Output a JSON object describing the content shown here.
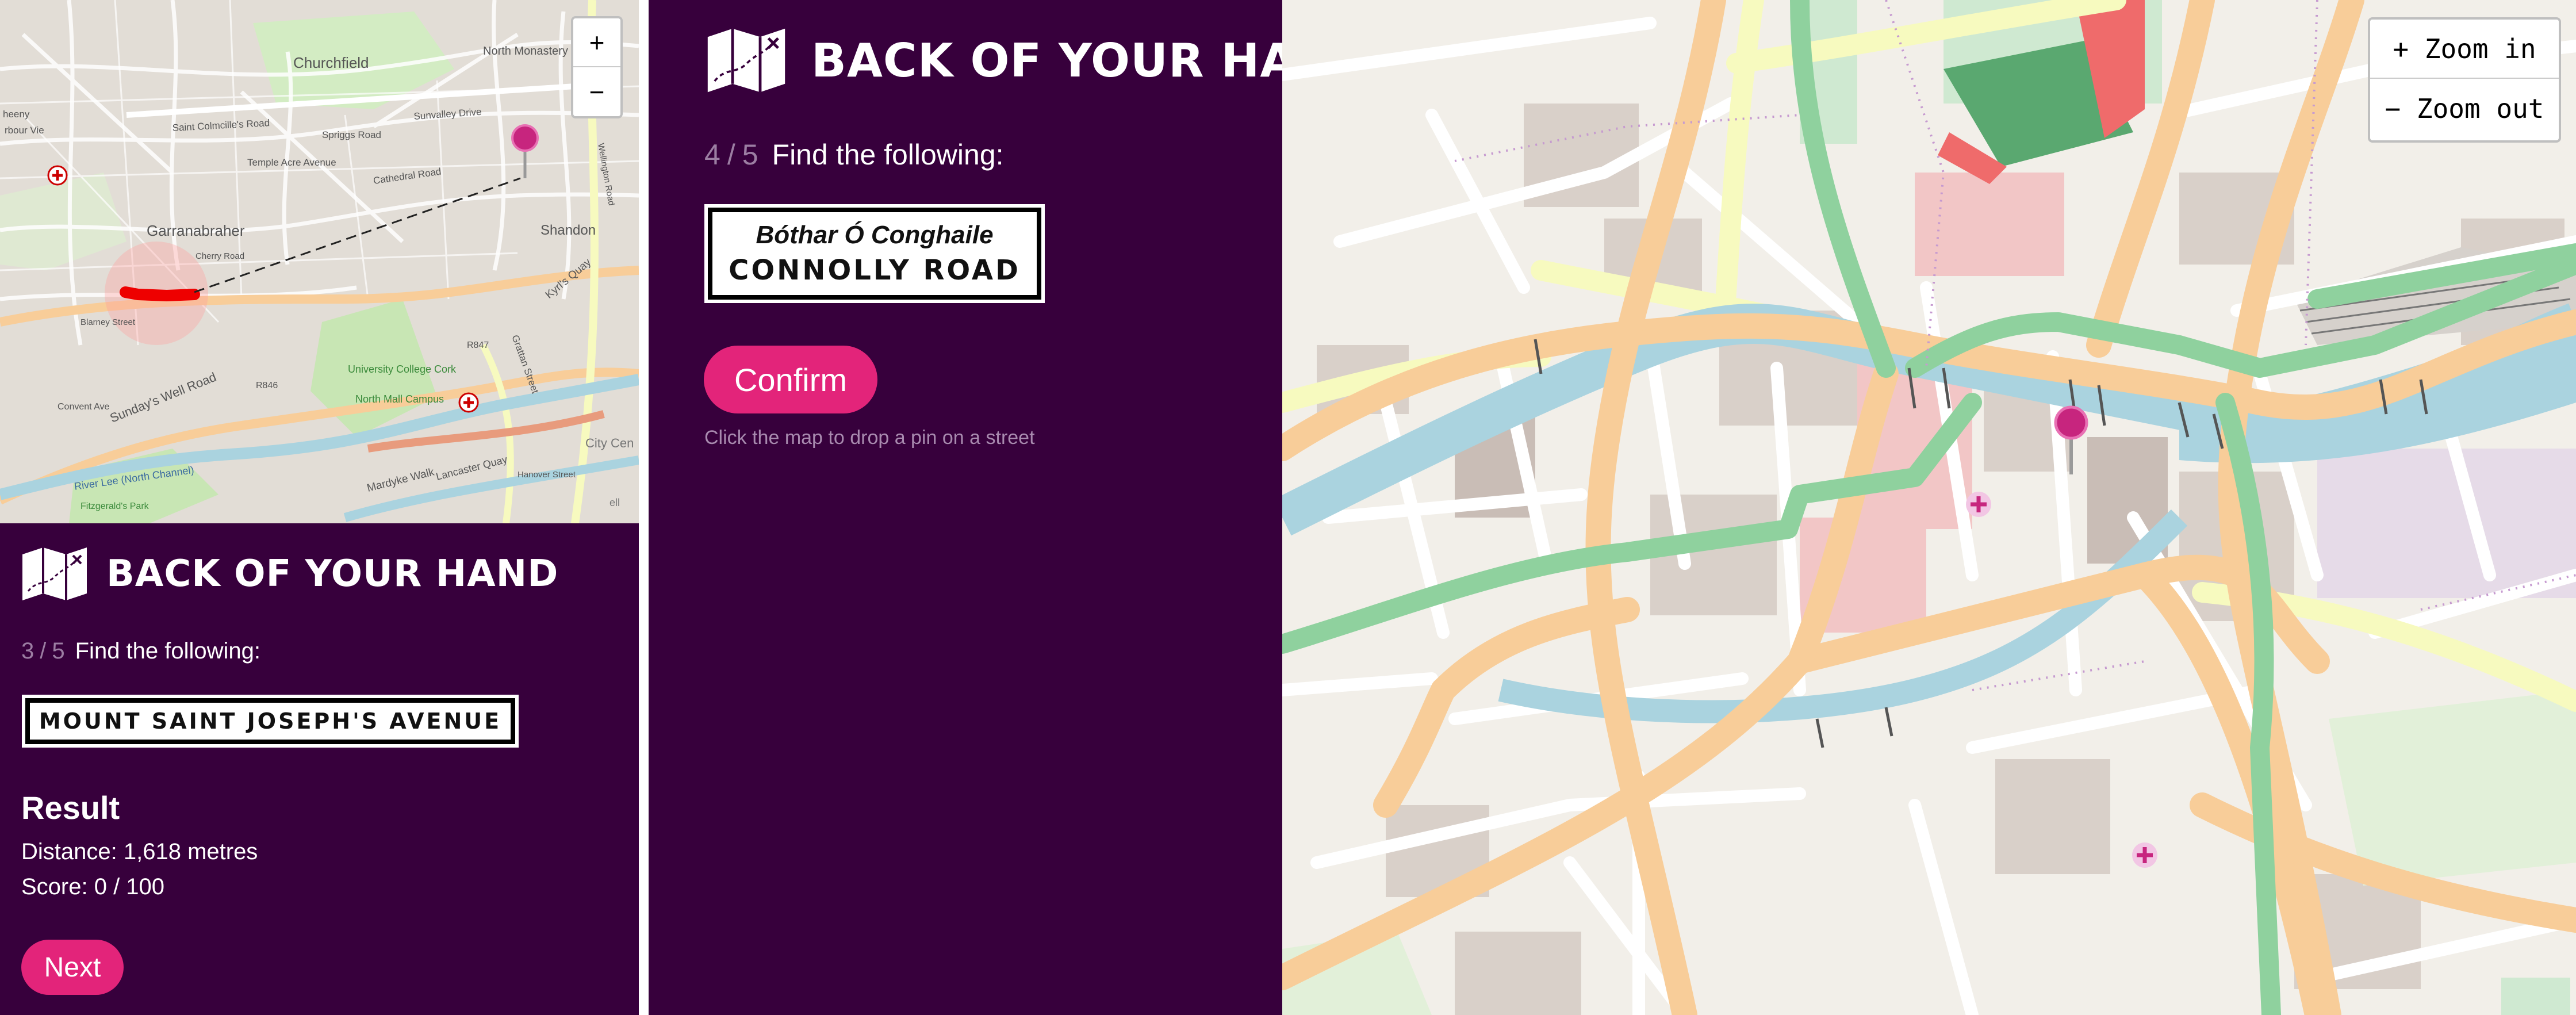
{
  "app": {
    "title": "BACK OF YOUR HAND"
  },
  "colors": {
    "panel_bg": "#37003c",
    "accent": "#e3247a",
    "muted_text": "#9c7ea3",
    "map_land": "#efece6",
    "road_major": "#f8cd99",
    "road_secondary": "#f7fabf",
    "path_green": "#8fd19e",
    "river": "#aad3df"
  },
  "icons": {
    "logo": "folded-map-icon",
    "pin": "map-pin-icon",
    "hospital": "hospital-cross-icon"
  },
  "panel_small": {
    "zoom": {
      "in_label": "+",
      "out_label": "−"
    },
    "map_labels": {
      "churchfield": "Churchfield",
      "north_monastery": "North Monastery",
      "saint_colmcilles_road": "Saint Colmcille's Road",
      "spriggs_road": "Spriggs Road",
      "sunvalley_drive": "Sunvalley Drive",
      "temple_acre_avenue": "Temple Acre Avenue",
      "cathedral_road": "Cathedral Road",
      "garranabraher": "Garranabraher",
      "shandon": "Shandon",
      "kyrls_quay": "Kyrl's Quay",
      "university_college_cork": "University College Cork",
      "north_mall_campus": "North Mall Campus",
      "river_lee_north_channel": "River Lee (North Channel)",
      "sundays_well_road": "Sunday's Well Road",
      "mardyke_walk": "Mardyke Walk",
      "lancaster_quay": "Lancaster Quay",
      "city_centre": "City Cen",
      "fitzgeralds_park": "Fitzgerald's Park",
      "r846": "R846",
      "r847": "R847",
      "cherry_road": "Cherry Road",
      "convent_ave": "Convent Ave",
      "blarney_street": "Blarney Street",
      "grattan_street": "Grattan Street",
      "hanover_street": "Hanover Street",
      "wellington_road": "Wellington Road",
      "ell": "ell",
      "harbour": "rbour Vie",
      "cheeny": "heeny"
    },
    "round_current": "3",
    "round_total": "5",
    "round_sep": "/",
    "find_label": "Find the following:",
    "street_name": "MOUNT SAINT JOSEPH'S AVENUE",
    "result_heading": "Result",
    "distance_text": "Distance: 1,618 metres",
    "score_text": "Score: 0 / 100",
    "next_label": "Next"
  },
  "panel_main": {
    "round_current": "4",
    "round_total": "5",
    "round_sep": "/",
    "find_label": "Find the following:",
    "street_name_irish": "Bóthar Ó Conghaile",
    "street_name": "CONNOLLY ROAD",
    "confirm_label": "Confirm",
    "hint": "Click the map to drop a pin on a street"
  },
  "big_map": {
    "zoom_in_label": "+ Zoom in",
    "zoom_out_label": "− Zoom out"
  }
}
